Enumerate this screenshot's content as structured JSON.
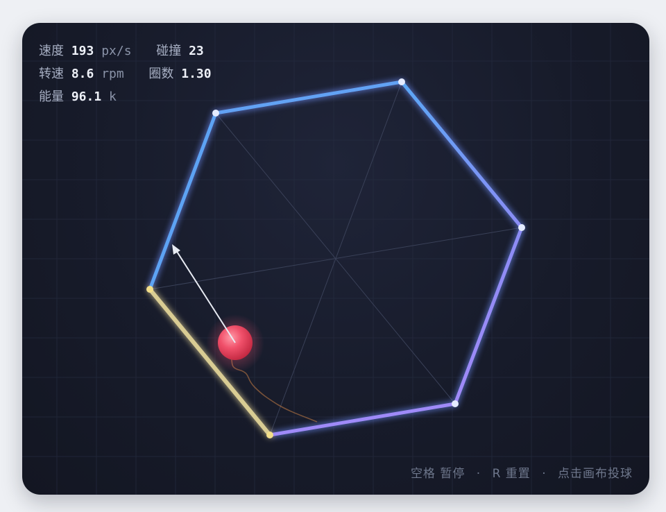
{
  "hud": {
    "speed_label": "速度",
    "speed_value": "193",
    "speed_unit": "px/s",
    "collisions_label": "碰撞",
    "collisions_value": "23",
    "rotation_label": "转速",
    "rotation_value": "8.6",
    "rotation_unit": "rpm",
    "turns_label": "圈数",
    "turns_value": "1.30",
    "energy_label": "能量",
    "energy_value": "96.1",
    "energy_unit": "k"
  },
  "hint": {
    "space_key": "空格",
    "pause": "暂停",
    "separator": "·",
    "r_key": "R",
    "reset": "重置",
    "click_action": "点击画布投球"
  },
  "colors": {
    "background": "#eef0f4",
    "canvas": "#171b2a",
    "edge_blue": "#60a5fa",
    "edge_violet": "#a78bfa",
    "edge_hit": "#e8d79a",
    "ball": "#f0506a",
    "trail": "#d98a4a"
  },
  "icons": {
    "ball": "ball-icon",
    "velocity_arrow": "arrow-icon"
  }
}
